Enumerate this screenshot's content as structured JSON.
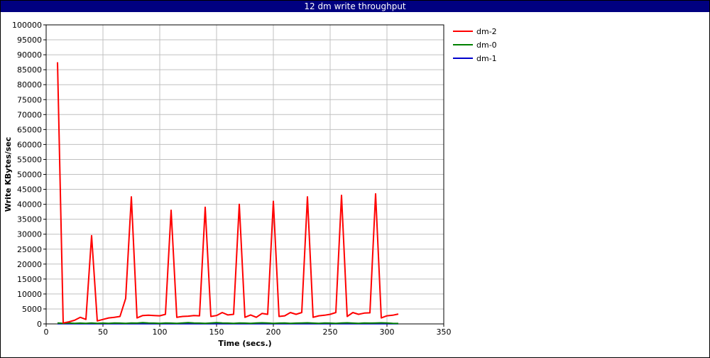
{
  "chart_data": {
    "type": "line",
    "title": "12 dm write throughput",
    "xlabel": "Time (secs.)",
    "ylabel": "Write KBytes/sec",
    "xlim": [
      0,
      350
    ],
    "ylim": [
      0,
      100000
    ],
    "x_ticks": [
      0,
      50,
      100,
      150,
      200,
      250,
      300,
      350
    ],
    "y_ticks": [
      0,
      5000,
      10000,
      15000,
      20000,
      25000,
      30000,
      35000,
      40000,
      45000,
      50000,
      55000,
      60000,
      65000,
      70000,
      75000,
      80000,
      85000,
      90000,
      95000,
      100000
    ],
    "grid": true,
    "legend_position": "top-right",
    "series": [
      {
        "name": "dm-2",
        "color": "#ff0000",
        "x": [
          10,
          15,
          20,
          25,
          30,
          35,
          40,
          45,
          50,
          55,
          60,
          65,
          70,
          75,
          80,
          85,
          90,
          95,
          100,
          105,
          110,
          115,
          120,
          125,
          130,
          135,
          140,
          145,
          150,
          155,
          160,
          165,
          170,
          175,
          180,
          185,
          190,
          195,
          200,
          205,
          210,
          215,
          220,
          225,
          230,
          235,
          240,
          245,
          250,
          255,
          260,
          265,
          270,
          275,
          280,
          285,
          290,
          295,
          300,
          305,
          310
        ],
        "y": [
          87500,
          300,
          700,
          1200,
          2200,
          1500,
          29500,
          1000,
          1500,
          2000,
          2200,
          2500,
          8500,
          42500,
          2000,
          2800,
          2900,
          2800,
          2700,
          3200,
          38000,
          2200,
          2500,
          2600,
          2800,
          2700,
          39000,
          2500,
          2800,
          3800,
          3000,
          3200,
          40000,
          2200,
          3000,
          2200,
          3500,
          3200,
          41000,
          2500,
          2700,
          3800,
          3200,
          3800,
          42500,
          2200,
          2700,
          2900,
          3200,
          3800,
          43000,
          2500,
          3800,
          3200,
          3600,
          3700,
          43500,
          2000,
          2700,
          2900,
          3300
        ]
      },
      {
        "name": "dm-0",
        "color": "#008000",
        "x": [
          10,
          15,
          20,
          25,
          30,
          35,
          40,
          45,
          50,
          55,
          60,
          65,
          70,
          75,
          80,
          85,
          90,
          95,
          100,
          105,
          110,
          115,
          120,
          125,
          130,
          135,
          140,
          145,
          150,
          155,
          160,
          165,
          170,
          175,
          180,
          185,
          190,
          195,
          200,
          205,
          210,
          215,
          220,
          225,
          230,
          235,
          240,
          245,
          250,
          255,
          260,
          265,
          270,
          275,
          280,
          285,
          290,
          295,
          300,
          305,
          310
        ],
        "y": [
          300,
          200,
          300,
          200,
          250,
          200,
          300,
          200,
          250,
          200,
          300,
          250,
          200,
          300,
          250,
          400,
          300,
          250,
          200,
          300,
          250,
          200,
          300,
          400,
          300,
          250,
          200,
          300,
          400,
          300,
          250,
          200,
          300,
          250,
          200,
          300,
          350,
          300,
          200,
          250,
          300,
          200,
          250,
          300,
          350,
          250,
          200,
          300,
          250,
          200,
          300,
          350,
          250,
          200,
          300,
          250,
          300,
          350,
          300,
          200,
          150
        ]
      },
      {
        "name": "dm-1",
        "color": "#0000cc",
        "x": [
          10,
          15,
          20,
          25,
          30,
          35,
          40,
          45,
          50,
          55,
          60,
          65,
          70,
          75,
          80,
          85,
          90,
          95,
          100,
          105,
          110,
          115,
          120,
          125,
          130,
          135,
          140,
          145,
          150,
          155,
          160,
          165,
          170,
          175,
          180,
          185,
          190,
          195,
          200,
          205,
          210,
          215,
          220,
          225,
          230,
          235,
          240,
          245,
          250,
          255,
          260,
          265,
          270,
          275,
          280,
          285,
          290,
          295,
          300,
          305,
          310
        ],
        "y": [
          50,
          50,
          50,
          50,
          50,
          50,
          50,
          50,
          50,
          50,
          50,
          50,
          50,
          50,
          50,
          50,
          50,
          50,
          50,
          50,
          50,
          50,
          50,
          50,
          50,
          50,
          50,
          50,
          50,
          50,
          50,
          50,
          50,
          50,
          50,
          50,
          50,
          50,
          50,
          50,
          50,
          50,
          50,
          50,
          50,
          50,
          50,
          50,
          50,
          50,
          50,
          50,
          50,
          50,
          50,
          50,
          50,
          50,
          50,
          50,
          50
        ]
      }
    ]
  }
}
